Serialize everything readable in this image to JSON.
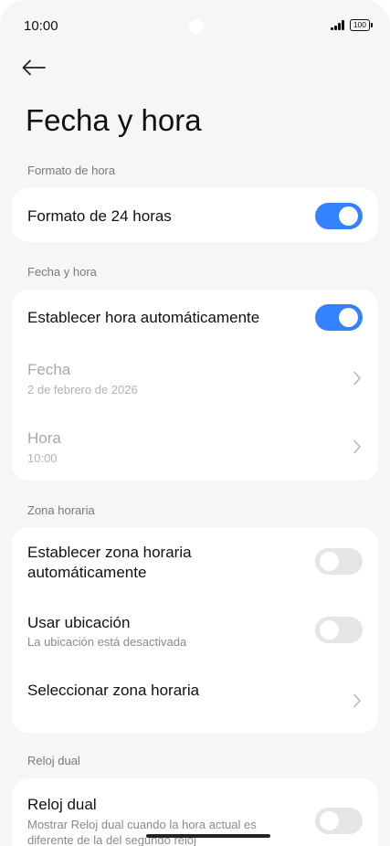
{
  "status_bar": {
    "time": "10:00",
    "battery": "100"
  },
  "page": {
    "title": "Fecha y hora"
  },
  "sections": {
    "time_format": {
      "label": "Formato de hora",
      "format_24h": {
        "title": "Formato de 24 horas",
        "enabled": true
      }
    },
    "date_time": {
      "label": "Fecha y hora",
      "auto_time": {
        "title": "Establecer hora automáticamente",
        "enabled": true
      },
      "date": {
        "title": "Fecha",
        "value": "2 de febrero de 2026"
      },
      "time": {
        "title": "Hora",
        "value": "10:00"
      }
    },
    "timezone": {
      "label": "Zona horaria",
      "auto_zone": {
        "title_line1": "Establecer zona horaria",
        "title_line2": "automáticamente",
        "enabled": false
      },
      "use_location": {
        "title": "Usar ubicación",
        "subtitle": "La ubicación está desactivada",
        "enabled": false
      },
      "select_zone": {
        "title": "Seleccionar zona horaria"
      }
    },
    "dual_clock": {
      "label": "Reloj dual",
      "dual": {
        "title": "Reloj dual",
        "subtitle_line1": "Mostrar Reloj dual cuando la hora actual es",
        "subtitle_line2": "diferente de la del segundo reloj",
        "enabled": false
      }
    }
  },
  "colors": {
    "accent": "#3482ff",
    "toggle_off": "#e5e5e5",
    "background": "#f6f6f6"
  },
  "icons": {
    "back": "arrow-left-icon",
    "chevron": "chevron-right-icon"
  }
}
